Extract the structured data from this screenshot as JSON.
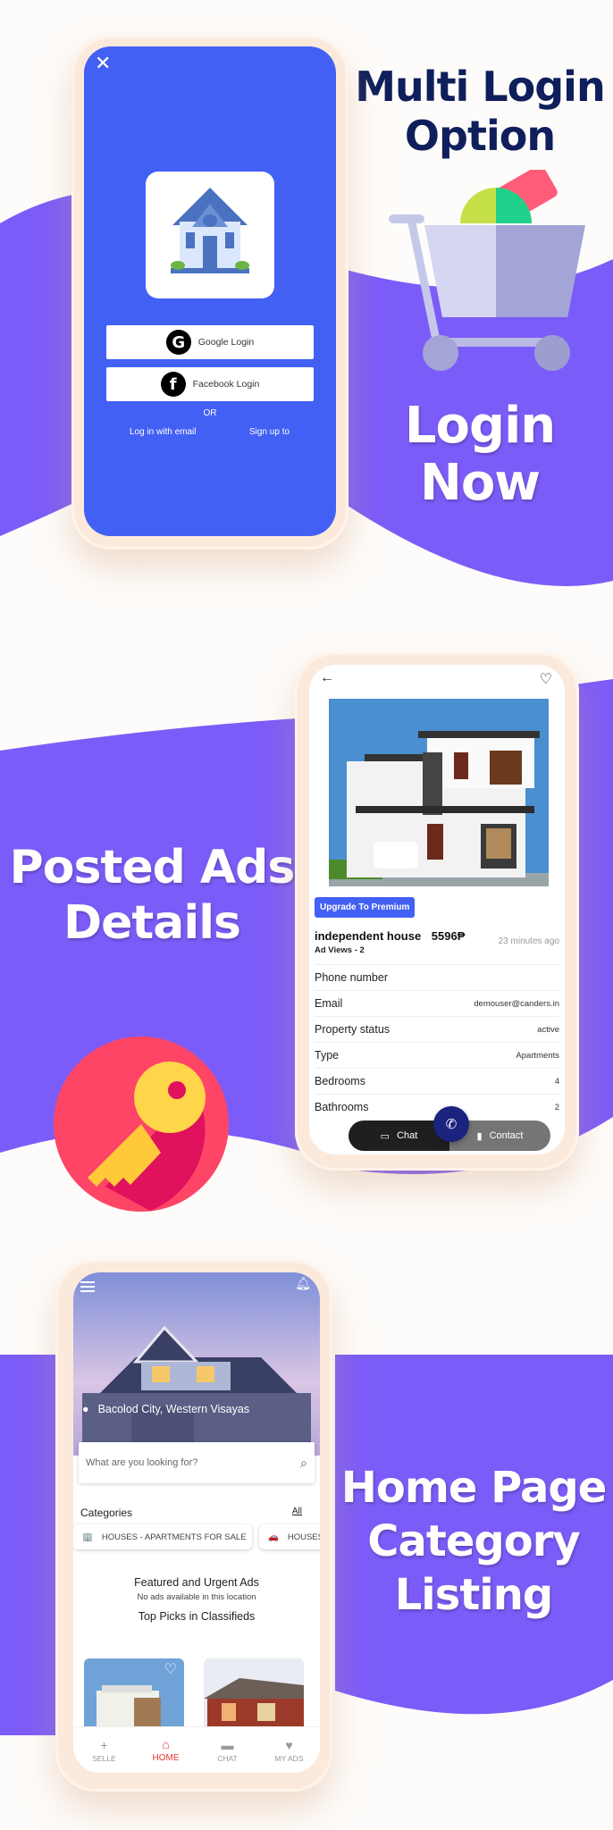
{
  "colors": {
    "purple": "#7c5cf8",
    "login_blue": "#4360f4",
    "navy_text": "#0f1f5c",
    "fab_navy": "#1a237e",
    "nav_active": "#e53935"
  },
  "section1": {
    "headline": [
      "Multi Login",
      "Option"
    ],
    "subheadline": [
      "Login",
      "Now"
    ],
    "login_screen": {
      "close_icon": "close-icon",
      "google_label": "Google Login",
      "facebook_label": "Facebook Login",
      "or_label": "OR",
      "email_login_label": "Log in with email",
      "signup_label": "Sign up to"
    }
  },
  "section2": {
    "headline": [
      "Posted Ads",
      "Details"
    ],
    "details_screen": {
      "back_icon": "arrow-left-icon",
      "favorite_icon": "heart-icon",
      "premium_button": "Upgrade To Premium",
      "title": "independent house",
      "price": "5596₱",
      "ad_views": "Ad Views - 2",
      "posted_time": "23 minutes ago",
      "rows": [
        {
          "label": "Phone number",
          "value": ""
        },
        {
          "label": "Email",
          "value": "demouser@canders.in"
        },
        {
          "label": "Property status",
          "value": "active"
        },
        {
          "label": "Type",
          "value": "Apartments"
        },
        {
          "label": "Bedrooms",
          "value": "4"
        },
        {
          "label": "Bathrooms",
          "value": "2"
        }
      ],
      "chat_label": "Chat",
      "contact_label": "Contact"
    }
  },
  "section3": {
    "headline": [
      "Home Page",
      "Category",
      "Listing"
    ],
    "home_screen": {
      "location": "Bacolod City, Western Visayas",
      "search_placeholder": "What are you looking for?",
      "categories_heading": "Categories",
      "categories_all": "All",
      "categories": [
        {
          "label": "HOUSES - APARTMENTS FOR SALE",
          "icon": "🏢"
        },
        {
          "label": "HOUSES",
          "icon": "🚗"
        }
      ],
      "featured_title": "Featured and Urgent Ads",
      "featured_empty": "No ads available in this location",
      "top_picks_title": "Top Picks in Classifieds",
      "nav": [
        {
          "label": "SELLE",
          "icon": "+"
        },
        {
          "label": "HOME",
          "icon": "⌂"
        },
        {
          "label": "CHAT",
          "icon": "▬"
        },
        {
          "label": "MY ADS",
          "icon": "♥"
        }
      ]
    }
  }
}
